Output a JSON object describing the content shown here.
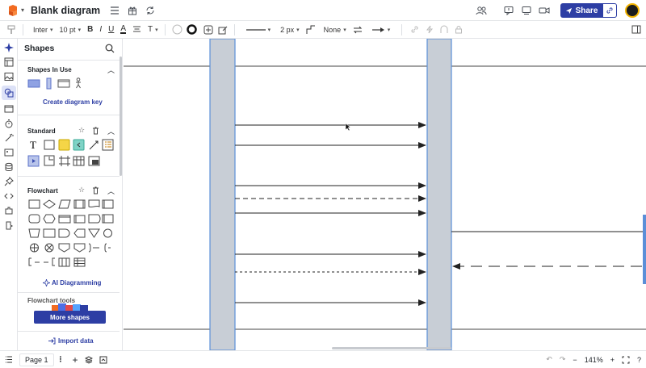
{
  "app": {
    "title": "Blank diagram",
    "share_label": "Share"
  },
  "format": {
    "font": "Inter",
    "font_size": "10 pt",
    "line_width": "2 px",
    "arrow_start": "None"
  },
  "panel": {
    "title": "Shapes",
    "shapes_in_use_title": "Shapes In Use",
    "create_key_label": "Create diagram key",
    "standard_title": "Standard",
    "flowchart_title": "Flowchart",
    "ai_label": "AI Diagramming",
    "flowchart_tools_title": "Flowchart tools",
    "more_shapes_label": "More shapes",
    "import_label": "Import data"
  },
  "footer": {
    "page_label": "Page 1",
    "zoom": "141%"
  },
  "colors": {
    "accent": "#2d3ea4",
    "lifeline_fill": "#c8ced6",
    "lifeline_stroke": "#5b8fd8"
  }
}
